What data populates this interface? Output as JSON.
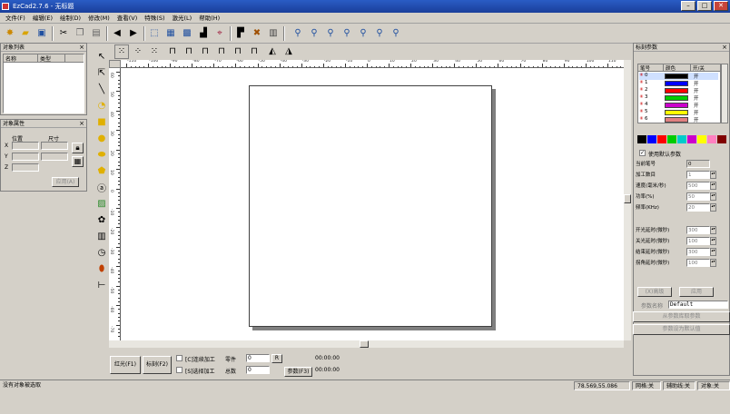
{
  "window": {
    "title": "EzCad2.7.6 - 无标题",
    "min": "–",
    "max": "□",
    "close": "✕"
  },
  "menu": [
    "文件(F)",
    "编辑(E)",
    "绘制(D)",
    "修改(M)",
    "查看(V)",
    "特殊(S)",
    "激光(L)",
    "帮助(H)"
  ],
  "toolbar_icons": [
    "new-file-icon",
    "open-icon",
    "save-icon",
    "cut-icon",
    "copy-icon",
    "paste-icon",
    "undo-icon",
    "redo-icon",
    "select-all-icon",
    "group-icon",
    "ungroup-icon",
    "align-icon",
    "node-icon",
    "node-edit-icon",
    "node-delete-icon",
    "mirror-icon",
    "tools-icon",
    "properties-icon",
    "zoom-icon",
    "zoom-in-icon",
    "zoom-out-icon",
    "zoom-fit-icon",
    "zoom-all-icon",
    "zoom-select-icon",
    "zoom-page-icon"
  ],
  "object_list": {
    "title": "对象列表",
    "col_name": "名称",
    "col_type": "类型"
  },
  "object_props": {
    "title": "对象属性",
    "col_pos": "位置",
    "col_size": "尺寸",
    "x": "X",
    "y": "Y",
    "z": "Z",
    "apply": "应用(A)"
  },
  "draw_tools": [
    "select-arrow-icon",
    "node-arrow-icon",
    "line-icon",
    "curve-icon",
    "rectangle-icon",
    "circle-icon",
    "ellipse-icon",
    "polygon-icon",
    "text-icon",
    "bitmap-icon",
    "vector-file-icon",
    "barcode-icon",
    "timer-icon",
    "io-input-icon",
    "io-output-icon"
  ],
  "ruler": {
    "h_labels": [
      "-110",
      "-100",
      "-90",
      "-80",
      "-70",
      "-60",
      "-50",
      "-40",
      "-30",
      "-20",
      "-10",
      "0",
      "10",
      "20",
      "30",
      "40",
      "50",
      "60",
      "70",
      "80",
      "90",
      "100",
      "110"
    ],
    "v_labels": [
      "60",
      "50",
      "40",
      "30",
      "20",
      "10",
      "0",
      "-10",
      "-20",
      "-30",
      "-40",
      "-50",
      "-60",
      "-70"
    ]
  },
  "mark_params": {
    "title": "标刻参数",
    "col_pen": "笔号",
    "col_color": "颜色",
    "col_onoff": "开/关",
    "pens": [
      {
        "no": "0",
        "color": "#000000",
        "state": "开"
      },
      {
        "no": "1",
        "color": "#0000ff",
        "state": "开"
      },
      {
        "no": "2",
        "color": "#ff0000",
        "state": "开"
      },
      {
        "no": "3",
        "color": "#00cc00",
        "state": "开"
      },
      {
        "no": "4",
        "color": "#cc00cc",
        "state": "开"
      },
      {
        "no": "5",
        "color": "#ffff00",
        "state": "开"
      },
      {
        "no": "6",
        "color": "#e08080",
        "state": "开"
      }
    ],
    "palette": [
      "#000000",
      "#0000ff",
      "#ff0000",
      "#00cc00",
      "#00cccc",
      "#cc00cc",
      "#ffff00",
      "#ff80c0",
      "#800000"
    ],
    "use_default": "使用默认参数",
    "current_pen_label": "当前笔号",
    "current_pen_value": "0",
    "params": [
      {
        "label": "加工数目",
        "value": "1"
      },
      {
        "label": "速度(毫米/秒)",
        "value": "500"
      },
      {
        "label": "功率(%)",
        "value": "50"
      },
      {
        "label": "频率(KHz)",
        "value": "20"
      }
    ],
    "delays": [
      {
        "label": "开光延时(微秒)",
        "value": "300"
      },
      {
        "label": "关光延时(微秒)",
        "value": "100"
      },
      {
        "label": "结束延时(微秒)",
        "value": "300"
      },
      {
        "label": "拐角延时(微秒)",
        "value": "100"
      }
    ],
    "adv_btn": "(X)高级",
    "apply_btn": "应用",
    "param_name_label": "参数名称",
    "param_name_value": "Default",
    "from_lib": "从参数库取参数",
    "set_default": "参数设为默认值"
  },
  "mark_controls": {
    "red_btn": "红光(F1)",
    "mark_btn": "标刻(F2)",
    "continuous": "[C]连续加工",
    "select_process": "[S]选择加工",
    "part_label": "零件",
    "part_value": "0",
    "total_label": "总数",
    "total_value": "0",
    "r_btn": "R",
    "params_btn": "参数(F3)",
    "time1": "00:00:00",
    "time2": "00:00:00"
  },
  "status": {
    "message": "没有对象被选取",
    "coords": "78.569,55.086",
    "grid": "网格:关",
    "guide": "辅助线:关",
    "snap": "对象:关"
  }
}
